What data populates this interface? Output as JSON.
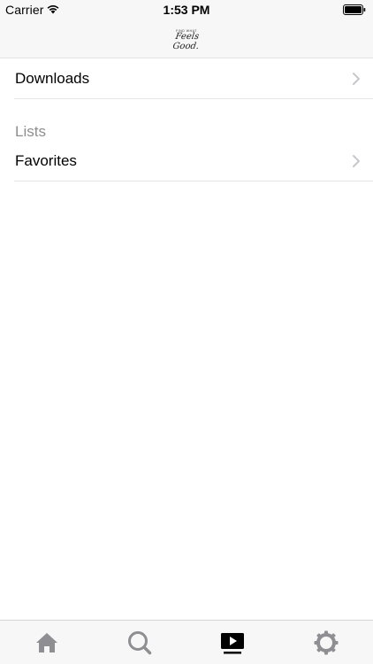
{
  "status_bar": {
    "carrier": "Carrier",
    "time": "1:53 PM",
    "wifi_icon": "wifi-icon",
    "battery_icon": "battery-icon"
  },
  "nav": {
    "logo_small_text": "Find what",
    "logo_text": "Feels Good."
  },
  "rows": {
    "downloads": {
      "label": "Downloads",
      "icon": "chevron-right-icon"
    },
    "section_lists": "Lists",
    "favorites": {
      "label": "Favorites",
      "icon": "chevron-right-icon"
    }
  },
  "tab_bar": {
    "tabs": [
      {
        "icon": "home-icon",
        "active": false
      },
      {
        "icon": "search-icon",
        "active": false
      },
      {
        "icon": "play-video-icon",
        "active": true
      },
      {
        "icon": "gear-icon",
        "active": false
      }
    ]
  },
  "colors": {
    "bar_background": "#f7f7f7",
    "section_header": "#8e8e8e",
    "chevron": "#c7c7cc",
    "tab_inactive": "#8e8e93",
    "tab_active": "#000000"
  }
}
